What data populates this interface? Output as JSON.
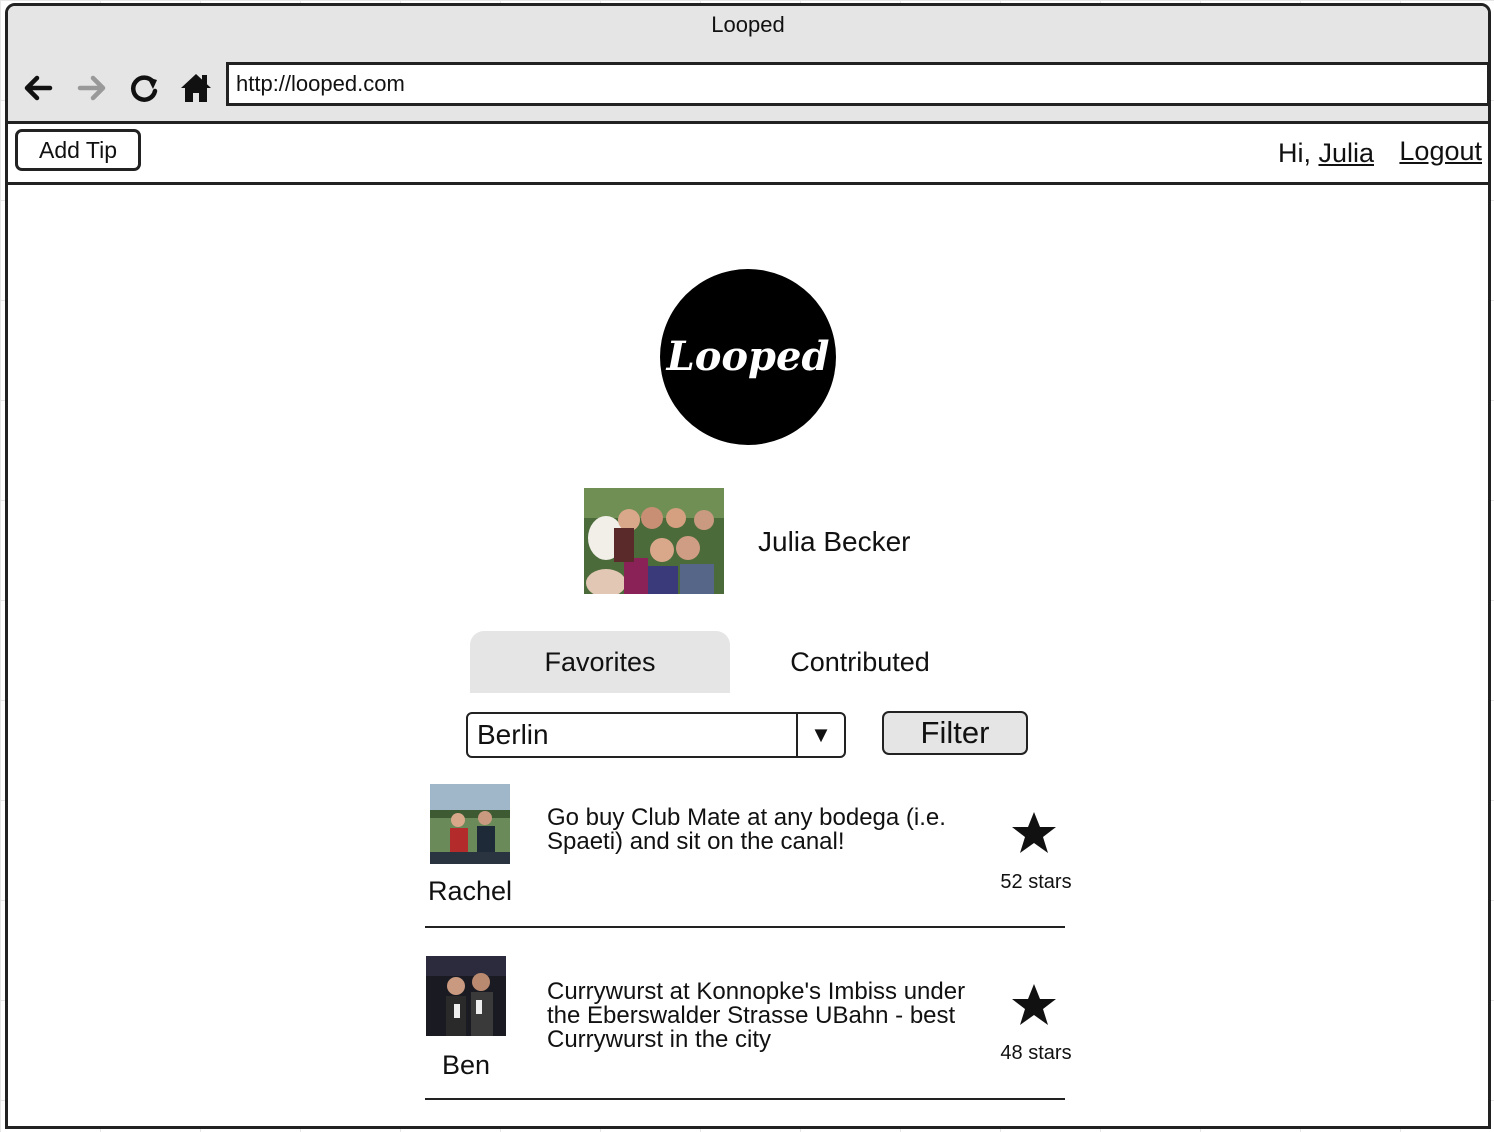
{
  "window": {
    "title": "Looped"
  },
  "browser": {
    "url": "http://looped.com",
    "nav_icons": [
      "back-arrow-icon",
      "forward-arrow-icon",
      "reload-icon",
      "home-icon"
    ]
  },
  "appbar": {
    "add_tip_label": "Add Tip",
    "greeting_prefix": "Hi,",
    "user_name": "Julia",
    "logout_label": "Logout"
  },
  "logo": {
    "text": "Looped",
    "color": "#000000"
  },
  "profile": {
    "name": "Julia Becker"
  },
  "tabs": [
    {
      "label": "Favorites",
      "active": true
    },
    {
      "label": "Contributed",
      "active": false
    }
  ],
  "filter": {
    "selected_city": "Berlin",
    "dropdown_glyph": "▼",
    "button_label": "Filter"
  },
  "tips": [
    {
      "author": "Rachel",
      "text": "Go buy Club Mate at any bodega (i.e. Spaeti) and sit on the canal!",
      "stars": "52 stars"
    },
    {
      "author": "Ben",
      "text": "Currywurst at Konnopke's Imbiss under the Eberswalder Strasse UBahn - best Currywurst in the city",
      "stars": "48 stars"
    }
  ],
  "colors": {
    "chrome": "#e5e5e5",
    "border": "#222222",
    "active_tab": "#e5e5e5"
  }
}
